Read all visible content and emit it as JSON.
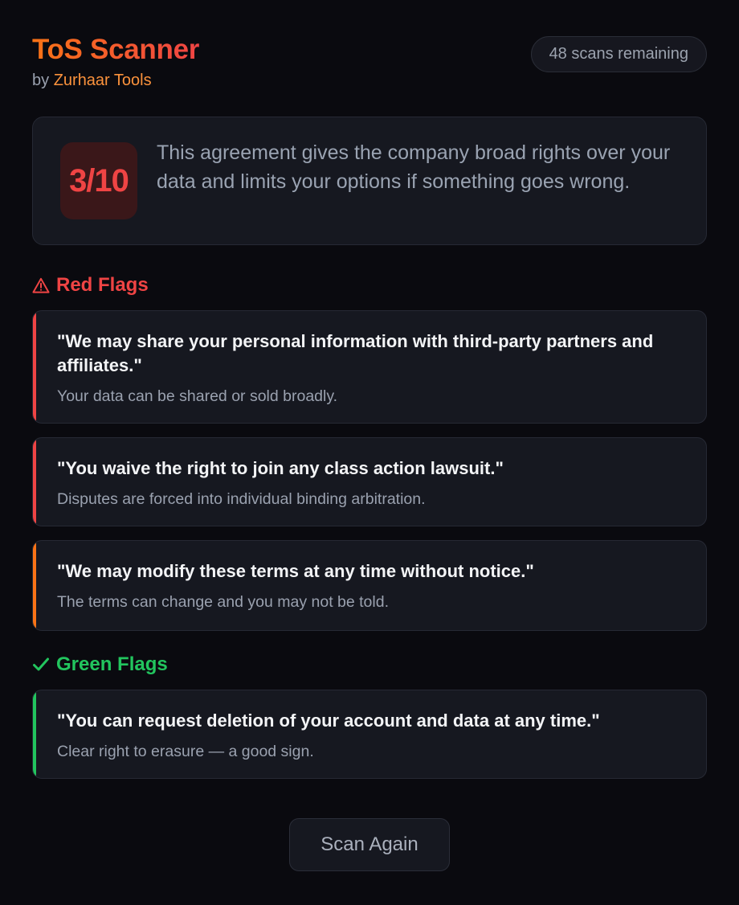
{
  "app": {
    "title": "ToS Scanner",
    "byline_prefix": "by",
    "brand": "Zurhaar Tools",
    "scans_remaining": "48 scans remaining"
  },
  "summary": {
    "score": "3/10",
    "text": "This agreement gives the company broad rights over your data and limits your options if something goes wrong."
  },
  "red_flags": {
    "title": "Red Flags",
    "icon": "warning-icon",
    "items": [
      {
        "quote": "\"We may share your personal information with third-party partners and affiliates.\"",
        "explanation": "Your data can be shared or sold broadly.",
        "accent": "#ef4444"
      },
      {
        "quote": "\"You waive the right to join any class action lawsuit.\"",
        "explanation": "Disputes are forced into individual binding arbitration.",
        "accent": "#ef4444"
      },
      {
        "quote": "\"We may modify these terms at any time without notice.\"",
        "explanation": "The terms can change and you may not be told.",
        "accent": "#f97316"
      }
    ]
  },
  "green_flags": {
    "title": "Green Flags",
    "icon": "checkmark-icon",
    "items": [
      {
        "quote": "\"You can request deletion of your account and data at any time.\"",
        "explanation": "Clear right to erasure — a good sign.",
        "accent": "#22c55e"
      }
    ]
  },
  "actions": {
    "scan_again": "Scan Again"
  },
  "colors": {
    "background": "#0a0a0f",
    "card": "#161820",
    "danger": "#ef4444",
    "warning": "#f97316",
    "success": "#22c55e",
    "brand": "#fb923c"
  }
}
